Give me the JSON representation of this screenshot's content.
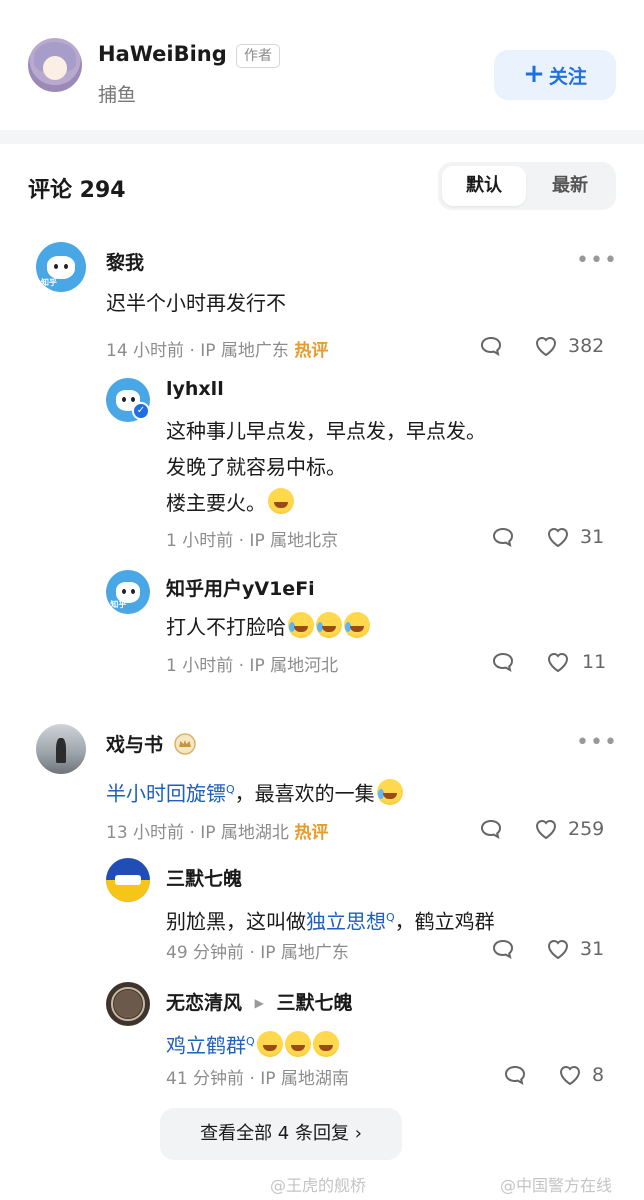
{
  "author": {
    "name": "HaWeiBing",
    "badge": "作者",
    "subtitle": "捕鱼",
    "follow_label": "关注",
    "follow_icon": "plus-icon"
  },
  "comments_header": {
    "label": "评论 294",
    "sort_options": [
      "默认",
      "最新"
    ],
    "selected": "默认"
  },
  "threads": [
    {
      "user": "黎我",
      "text": "迟半个小时再发行不",
      "time": "14 小时前 · IP 属地广东",
      "tag": "热评",
      "likes": "382",
      "replies": [
        {
          "user": "lyhxll",
          "lines": [
            "这种事儿早点发，早点发，早点发。",
            "发晚了就容易中标。",
            "楼主要火。"
          ],
          "time": "1 小时前 · IP 属地北京",
          "likes": "31"
        },
        {
          "user": "知乎用户yV1eFi",
          "text": "打人不打脸哈",
          "time": "1 小时前 · IP 属地河北",
          "likes": "11"
        }
      ]
    },
    {
      "user": "戏与书",
      "text_link": "半小时回旋镖",
      "text_rest": "，最喜欢的一集",
      "time": "13 小时前 · IP 属地湖北",
      "tag": "热评",
      "likes": "259",
      "replies": [
        {
          "user": "三默七魄",
          "text_pre": "别尬黑，这叫做",
          "text_link": "独立思想",
          "text_post": "，鹤立鸡群",
          "time": "49 分钟前 · IP 属地广东",
          "likes": "31"
        },
        {
          "user": "无恋清风",
          "reply_to": "三默七魄",
          "text_link": "鸡立鹤群",
          "time": "41 分钟前 · IP 属地湖南",
          "likes": "8"
        }
      ],
      "view_all": "查看全部 4 条回复"
    }
  ],
  "watermarks": [
    "@王虎的舰桥",
    "@中国警方在线"
  ],
  "colors": {
    "accent": "#1f6fe0",
    "hot": "#e89a2c",
    "link": "#1f5fbf"
  }
}
